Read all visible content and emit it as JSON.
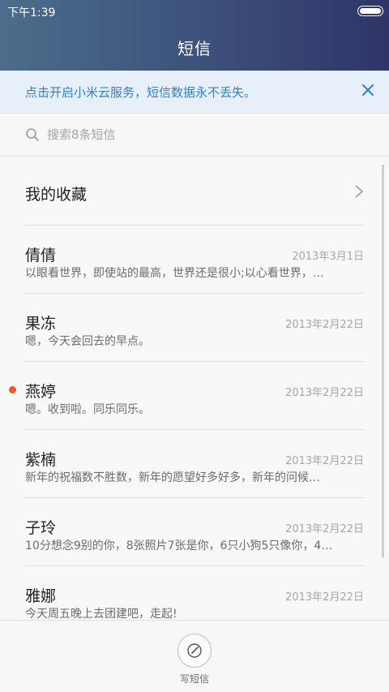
{
  "status_bar": {
    "time": "下午1:39"
  },
  "header": {
    "title": "短信"
  },
  "banner": {
    "text": "点击开启小米云服务，短信数据永不丢失。"
  },
  "search": {
    "placeholder": "搜索8条短信"
  },
  "favorites": {
    "label": "我的收藏"
  },
  "messages": [
    {
      "name": "倩倩",
      "date": "2013年3月1日",
      "snippet": "以眼看世界，即使站的最高，世界还是很小;以心看世界，…",
      "unread": false
    },
    {
      "name": "果冻",
      "date": "2013年2月22日",
      "snippet": "嗯，今天会回去的早点。",
      "unread": false
    },
    {
      "name": "燕婷",
      "date": "2013年2月22日",
      "snippet": "嗯。收到啦。同乐同乐。",
      "unread": true
    },
    {
      "name": "紫楠",
      "date": "2013年2月22日",
      "snippet": "新年的祝福数不胜数，新年的愿望好多好多，新年的问候…",
      "unread": false
    },
    {
      "name": "子玲",
      "date": "2013年2月22日",
      "snippet": "10分想念9别的你，8张照片7张是你，6只小狗5只像你，4…",
      "unread": false
    },
    {
      "name": "雅娜",
      "date": "2013年2月22日",
      "snippet": "今天周五晚上去团建吧，走起!",
      "unread": false
    }
  ],
  "bottom": {
    "compose_label": "写短信"
  },
  "colors": {
    "accent": "#2f7fd0",
    "unread_dot": "#f15a22"
  }
}
